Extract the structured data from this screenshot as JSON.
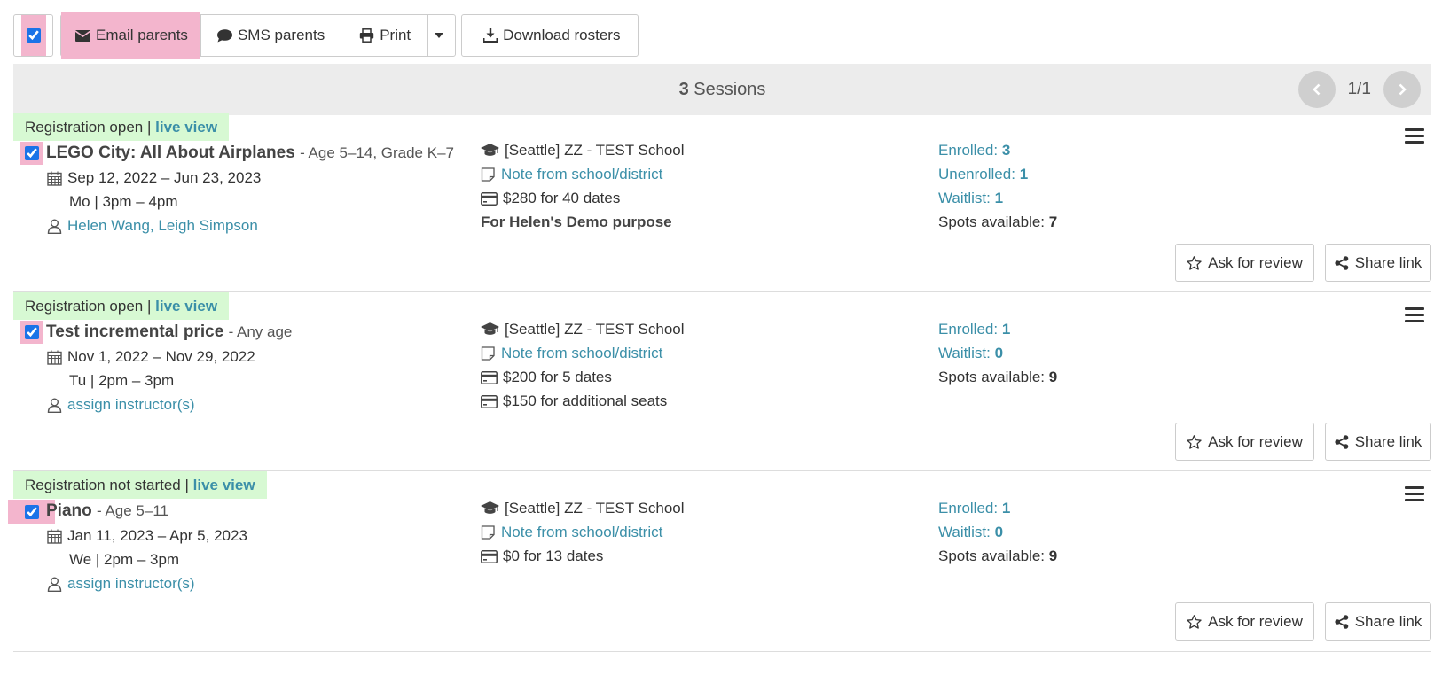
{
  "toolbar": {
    "email_label": "Email parents",
    "sms_label": "SMS parents",
    "print_label": "Print",
    "download_label": "Download rosters"
  },
  "summary": {
    "count": "3",
    "label": "Sessions",
    "page": "1/1"
  },
  "sessions": [
    {
      "status": "Registration open",
      "live_view": "live view",
      "name": "LEGO City: All About Airplanes",
      "meta": "- Age 5–14, Grade K–7",
      "dates": "Sep 12, 2022 – Jun 23, 2023",
      "schedule": "Mo | 3pm – 4pm",
      "instructors": "Helen Wang, Leigh Simpson",
      "school": "[Seattle] ZZ - TEST School",
      "note": "Note from school/district",
      "price": "$280 for 40 dates",
      "extra": "For Helen's Demo purpose",
      "enrolled_label": "Enrolled:",
      "enrolled": "3",
      "unenrolled_label": "Unenrolled:",
      "unenrolled": "1",
      "waitlist_label": "Waitlist:",
      "waitlist": "1",
      "spots_label": "Spots available:",
      "spots": "7",
      "review_label": "Ask for review",
      "share_label": "Share link"
    },
    {
      "status": "Registration open",
      "live_view": "live view",
      "name": "Test incremental price",
      "meta": "- Any age",
      "dates": "Nov 1, 2022 – Nov 29, 2022",
      "schedule": "Tu | 2pm – 3pm",
      "instructors": "assign instructor(s)",
      "school": "[Seattle] ZZ - TEST School",
      "note": "Note from school/district",
      "price": "$200 for 5 dates",
      "price2": "$150 for additional seats",
      "enrolled_label": "Enrolled:",
      "enrolled": "1",
      "waitlist_label": "Waitlist:",
      "waitlist": "0",
      "spots_label": "Spots available:",
      "spots": "9",
      "review_label": "Ask for review",
      "share_label": "Share link"
    },
    {
      "status": "Registration not started",
      "live_view": "live view",
      "name": "Piano",
      "meta": "- Age 5–11",
      "dates": "Jan 11, 2023 – Apr 5, 2023",
      "schedule": "We | 2pm – 3pm",
      "instructors": "assign instructor(s)",
      "school": "[Seattle] ZZ - TEST School",
      "note": "Note from school/district",
      "price": "$0 for 13 dates",
      "enrolled_label": "Enrolled:",
      "enrolled": "1",
      "waitlist_label": "Waitlist:",
      "waitlist": "0",
      "spots_label": "Spots available:",
      "spots": "9",
      "review_label": "Ask for review",
      "share_label": "Share link"
    }
  ],
  "icons": {
    "check": "check-icon",
    "envelope": "envelope-icon",
    "comment": "comment-icon",
    "print": "print-icon",
    "caret": "caret-down-icon",
    "download": "download-icon",
    "cap": "graduation-cap-icon",
    "note": "note-icon",
    "card": "credit-card-icon",
    "calendar": "calendar-icon",
    "user": "user-icon",
    "star": "star-icon",
    "share": "share-icon",
    "menu": "hamburger-menu-icon"
  },
  "colors": {
    "accent": "#3b8fa8",
    "highlight": "#f3b5cd",
    "status_bg": "#d7f9d3"
  }
}
